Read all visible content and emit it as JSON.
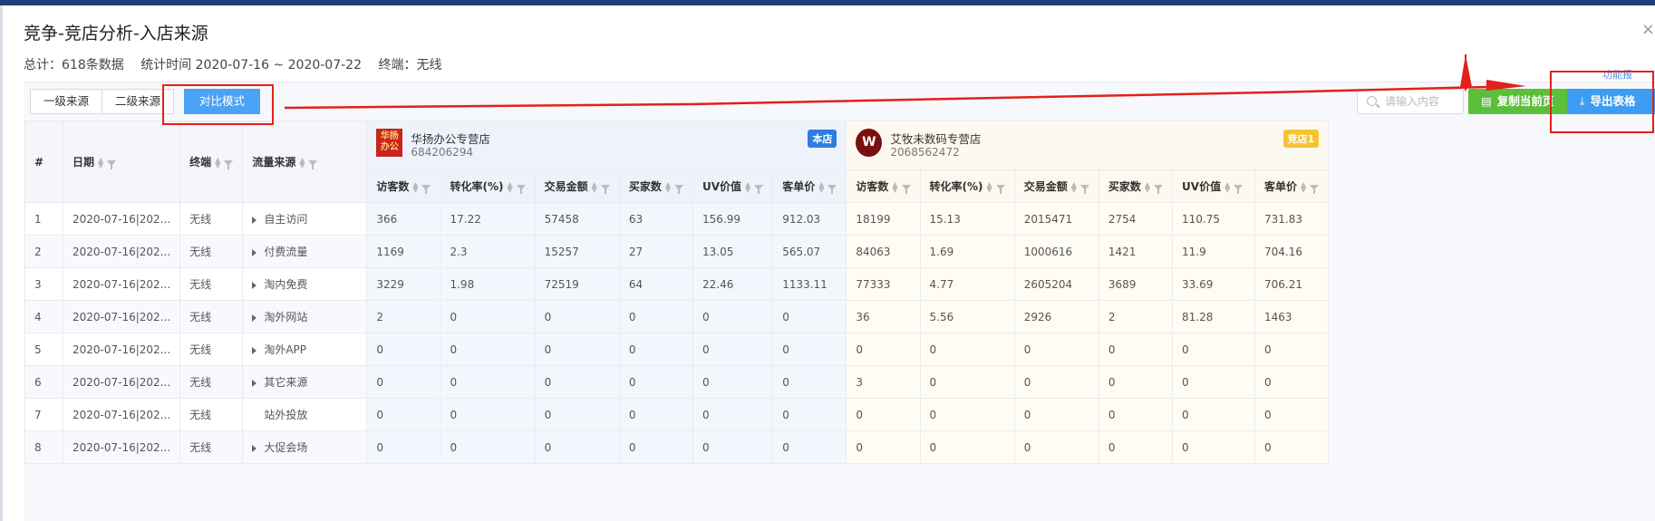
{
  "dialog": {
    "title": "竞争-竞店分析-入店来源",
    "close": "×",
    "summary": {
      "total": "总计：618条数据",
      "period": "统计时间 2020-07-16 ~ 2020-07-22",
      "terminal": "终端：无线"
    }
  },
  "tabs": [
    {
      "label": "一级来源",
      "active": false
    },
    {
      "label": "二级来源",
      "active": false
    },
    {
      "label": "对比模式",
      "active": true
    }
  ],
  "toolbar": {
    "func_link": "功能报",
    "search_placeholder": "请输入内容",
    "copy_label": "复制当前页",
    "export_label": "导出表格"
  },
  "table": {
    "fixed_headers": [
      "#",
      "日期",
      "终端",
      "流量来源"
    ],
    "stores": [
      {
        "name": "华扬办公专营店",
        "id": "684206294",
        "badge": "本店",
        "logo_text": "华扬办公"
      },
      {
        "name": "艾牧未数码专营店",
        "id": "2068562472",
        "badge": "竞店1",
        "logo_text": "W"
      }
    ],
    "metric_headers": [
      "访客数",
      "转化率(%)",
      "交易金额",
      "买家数",
      "UV价值",
      "客单价"
    ],
    "rows": [
      {
        "no": "1",
        "date": "2020-07-16|202...",
        "terminal": "无线",
        "source": "自主访问",
        "expand": true,
        "own": [
          "366",
          "17.22",
          "57458",
          "63",
          "156.99",
          "912.03"
        ],
        "comp": [
          "18199",
          "15.13",
          "2015471",
          "2754",
          "110.75",
          "731.83"
        ]
      },
      {
        "no": "2",
        "date": "2020-07-16|202...",
        "terminal": "无线",
        "source": "付费流量",
        "expand": true,
        "own": [
          "1169",
          "2.3",
          "15257",
          "27",
          "13.05",
          "565.07"
        ],
        "comp": [
          "84063",
          "1.69",
          "1000616",
          "1421",
          "11.9",
          "704.16"
        ]
      },
      {
        "no": "3",
        "date": "2020-07-16|202...",
        "terminal": "无线",
        "source": "淘内免费",
        "expand": true,
        "own": [
          "3229",
          "1.98",
          "72519",
          "64",
          "22.46",
          "1133.11"
        ],
        "comp": [
          "77333",
          "4.77",
          "2605204",
          "3689",
          "33.69",
          "706.21"
        ]
      },
      {
        "no": "4",
        "date": "2020-07-16|202...",
        "terminal": "无线",
        "source": "淘外网站",
        "expand": true,
        "own": [
          "2",
          "0",
          "0",
          "0",
          "0",
          "0"
        ],
        "comp": [
          "36",
          "5.56",
          "2926",
          "2",
          "81.28",
          "1463"
        ]
      },
      {
        "no": "5",
        "date": "2020-07-16|202...",
        "terminal": "无线",
        "source": "淘外APP",
        "expand": true,
        "own": [
          "0",
          "0",
          "0",
          "0",
          "0",
          "0"
        ],
        "comp": [
          "0",
          "0",
          "0",
          "0",
          "0",
          "0"
        ]
      },
      {
        "no": "6",
        "date": "2020-07-16|202...",
        "terminal": "无线",
        "source": "其它来源",
        "expand": true,
        "own": [
          "0",
          "0",
          "0",
          "0",
          "0",
          "0"
        ],
        "comp": [
          "3",
          "0",
          "0",
          "0",
          "0",
          "0"
        ]
      },
      {
        "no": "7",
        "date": "2020-07-16|202...",
        "terminal": "无线",
        "source": "站外投放",
        "expand": false,
        "own": [
          "0",
          "0",
          "0",
          "0",
          "0",
          "0"
        ],
        "comp": [
          "0",
          "0",
          "0",
          "0",
          "0",
          "0"
        ]
      },
      {
        "no": "8",
        "date": "2020-07-16|202...",
        "terminal": "无线",
        "source": "大促会场",
        "expand": true,
        "own": [
          "0",
          "0",
          "0",
          "0",
          "0",
          "0"
        ],
        "comp": [
          "0",
          "0",
          "0",
          "0",
          "0",
          "0"
        ]
      }
    ]
  },
  "colors": {
    "primary": "#3d9df2",
    "success": "#5cbf3a",
    "annotation": "#e3201b",
    "own_badge": "#2f7de1",
    "comp_badge": "#f3c431"
  }
}
